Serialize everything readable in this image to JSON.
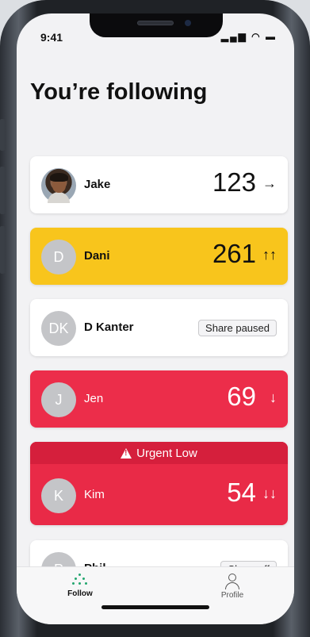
{
  "status": {
    "time": "9:41",
    "icons": "..ıl ≈ ▬"
  },
  "page": {
    "title": "You’re following"
  },
  "cards": [
    {
      "name": "Jake",
      "value": "123",
      "trend": "→",
      "color": "#ffffff"
    },
    {
      "name": "Dani",
      "initial": "D",
      "value": "261",
      "trend": "↑↑",
      "color": "#f8c51c"
    },
    {
      "name": "D Kanter",
      "initial": "DK",
      "badge": "Share paused",
      "color": "#ffffff"
    },
    {
      "name": "Jen",
      "initial": "J",
      "value": "69",
      "trend": "↓",
      "color": "#ec2d4a"
    },
    {
      "alert": "Urgent Low",
      "name": "Kim",
      "initial": "K",
      "value": "54",
      "trend": "↓↓",
      "color": "#e92a47"
    },
    {
      "name": "Phil",
      "initial": "P",
      "badge": "Share off",
      "color": "#ffffff"
    }
  ],
  "tabs": {
    "follow": "Follow",
    "profile": "Profile"
  },
  "colors": {
    "accent_green": "#22a66e",
    "alert_red": "#d51f3c",
    "yellow": "#f8c51c"
  }
}
